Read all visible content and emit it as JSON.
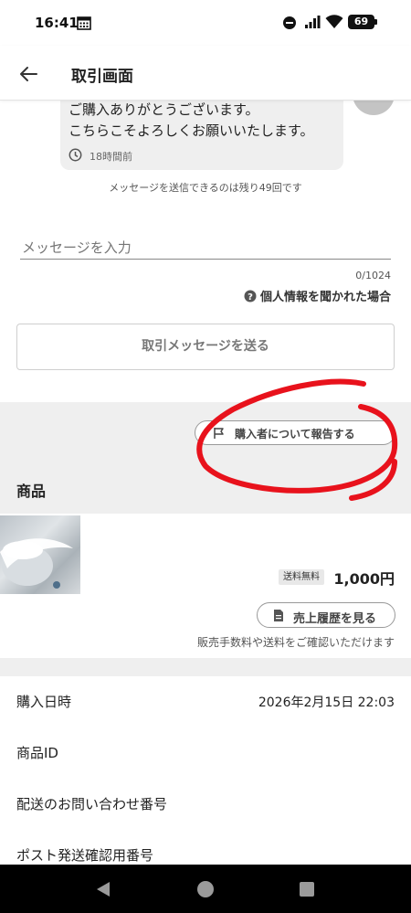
{
  "status_bar": {
    "time": "16:41",
    "battery": "69",
    "icons": [
      "calendar-icon",
      "dnd-icon",
      "signal-icon",
      "wifi-icon",
      "battery-icon"
    ]
  },
  "appbar": {
    "title": "取引画面",
    "back_icon": "arrow-left-icon"
  },
  "message": {
    "line1": "ご購入ありがとうございます。",
    "line2": "こちらこそよろしくお願いいたします。",
    "timestamp": "18時間前"
  },
  "compose": {
    "remaining_notice": "メッセージを送信できるのは残り49回です",
    "placeholder": "メッセージを入力",
    "counter": "0/1024",
    "privacy_link": "個人情報を聞かれた場合",
    "send_label": "取引メッセージを送る"
  },
  "report": {
    "label": "購入者について報告する"
  },
  "product": {
    "section_title": "商品",
    "shipping_badge": "送料無料",
    "price": "1,000円",
    "history_label": "売上履歴を見る",
    "fee_note": "販売手数料や送料をご確認いただけます"
  },
  "details": {
    "purchase_date_label": "購入日時",
    "purchase_date_value": "2026年2月15日 22:03",
    "product_id_label": "商品ID",
    "tracking_label": "配送のお問い合わせ番号",
    "post_label": "ポスト発送確認用番号"
  },
  "colors": {
    "annotation_red": "#e8121c",
    "gray_bg": "#efefef"
  }
}
